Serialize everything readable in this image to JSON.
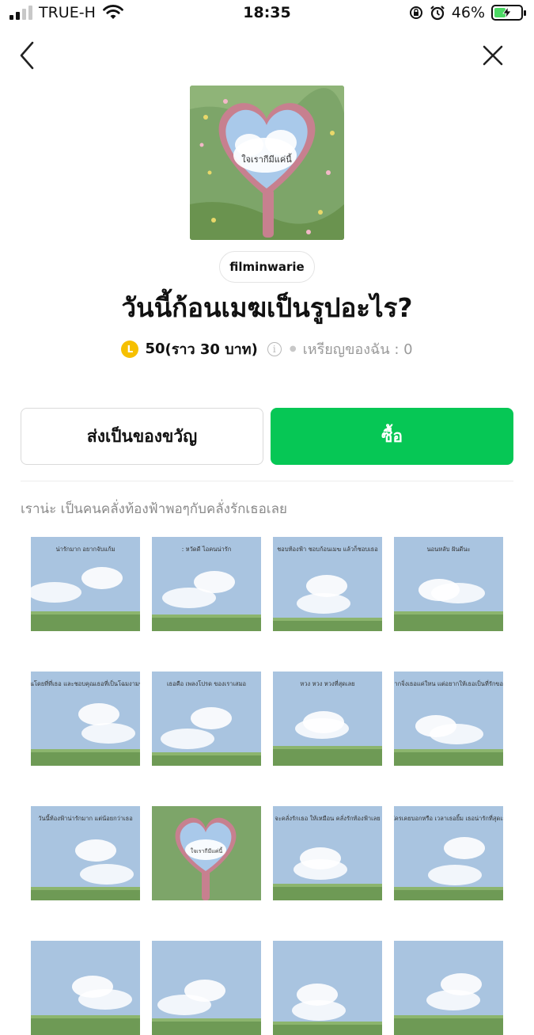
{
  "status_bar": {
    "carrier": "TRUE-H",
    "time": "18:35",
    "battery": "46%",
    "battery_level": 0.46,
    "icons": [
      "signal-icon",
      "wifi-icon",
      "orientation-lock-icon",
      "alarm-icon",
      "battery-charging-icon"
    ]
  },
  "nav": {
    "back_icon": "chevron-left-icon",
    "close_icon": "close-icon"
  },
  "product": {
    "hero_text": "ใจเรากีมีแค่นี้",
    "author": "filminwarie",
    "title": "วันนี้ก้อนเมฆเป็นรูปอะไร?",
    "price_coin_symbol": "L",
    "price_value": "50",
    "price_baht": "(ราว 30 บาท)",
    "info_symbol": "i",
    "my_coins": "เหรียญของฉัน : 0"
  },
  "actions": {
    "gift_label": "ส่งเป็นของขวัญ",
    "buy_label": "ซื้อ"
  },
  "colors": {
    "accent_green": "#06c755",
    "coin_yellow": "#f6c000",
    "sky_blue": "#a9c4e0",
    "grass_green": "#6e9a55"
  },
  "description": "เราน่ะ เป็นคนคลั่งท้องฟ้าพอๆกับคลั่งรักเธอเลย",
  "stickers": [
    {
      "caption": "น่ารักมาก อยากจับแก้ม"
    },
    {
      "caption": ": หวัดดี ไอคนน่ารัก"
    },
    {
      "caption": "ชอบท้องฟ้า ชอบก้อนเมฆ แล้วก็ชอบเธอ"
    },
    {
      "caption": "นอนหลับ ฝันดีนะ"
    },
    {
      "caption": "ชอบคุณโดยที่ที่เธอ และชอบคุณเธอที่เป็นโฉมงามของฉัน"
    },
    {
      "caption": "เธอคือ เพลงโปรด ของเราเสมอ"
    },
    {
      "caption": "หวง หวง หวงที่สุดเลย"
    },
    {
      "caption": "ถึงวันเราอยากจิ่งเธอแค่ใหน แต่อยากให้เธอเป็นที่รักของทุกคนด้วย"
    },
    {
      "caption": "วันนี้ท้องฟ้าน่ารักมาก แต่น้อยกว่าเธอ"
    },
    {
      "caption": "ใจเรากีมีแค่นี้"
    },
    {
      "caption": "จะคลั่งรักเธอ ให้เหมือน คลั่งรักท้องฟ้าเลย"
    },
    {
      "caption": "มีใครเคยบอกหรือ เวลาเธอยิ้ม เธอน่ารักที่สุดเลย"
    },
    {
      "caption": ""
    },
    {
      "caption": ""
    },
    {
      "caption": ""
    },
    {
      "caption": ""
    }
  ]
}
